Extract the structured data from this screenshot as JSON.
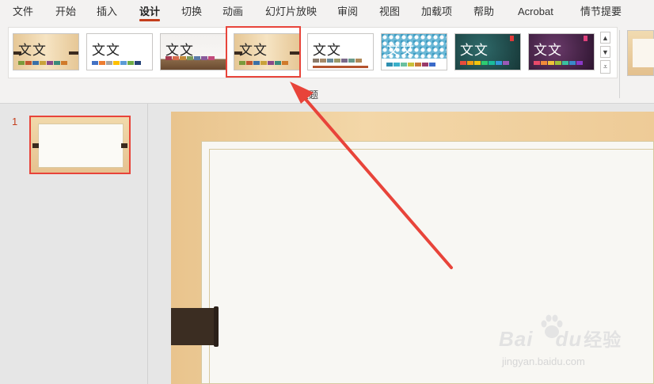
{
  "tabs": [
    "文件",
    "开始",
    "插入",
    "设计",
    "切换",
    "动画",
    "幻灯片放映",
    "审阅",
    "视图",
    "加载项",
    "帮助",
    "Acrobat",
    "情节提要"
  ],
  "active_tab": "设计",
  "ribbon": {
    "group_label": "主题",
    "themes": [
      {
        "sample": "文文",
        "swatches": [
          "#7a9a3a",
          "#c0552e",
          "#3a6fa6",
          "#c9a23a",
          "#8a4a8a",
          "#3a8a7a",
          "#d07a2a"
        ]
      },
      {
        "sample": "文文",
        "swatches": [
          "#4472c4",
          "#ed7d31",
          "#a5a5a5",
          "#ffc000",
          "#5b9bd5",
          "#70ad47",
          "#264478"
        ]
      },
      {
        "sample": "文文",
        "swatches": [
          "#a63a50",
          "#d66a4a",
          "#c28a3a",
          "#7a9a5a",
          "#5a7aa6",
          "#8a5a9a",
          "#c24a7a"
        ]
      },
      {
        "sample": "文文",
        "swatches": [
          "#7a9a3a",
          "#c0552e",
          "#3a6fa6",
          "#c9a23a",
          "#8a4a8a",
          "#3a8a7a",
          "#d07a2a"
        ]
      },
      {
        "sample": "文文",
        "swatches": [
          "#8a7a6a",
          "#a68a6a",
          "#6a8a9a",
          "#9a9a6a",
          "#7a6a8a",
          "#6a9a8a",
          "#b08a5a"
        ]
      },
      {
        "sample": "文文",
        "swatches": [
          "#2e8fb0",
          "#3ab0c9",
          "#6ac0a0",
          "#c9c03a",
          "#c97a3a",
          "#9a3a6a",
          "#3a6ac9"
        ]
      },
      {
        "sample": "文文",
        "swatches": [
          "#e74c3c",
          "#f39c12",
          "#f1c40f",
          "#2ecc71",
          "#1abc9c",
          "#3498db",
          "#9b59b6"
        ]
      },
      {
        "sample": "文文",
        "swatches": [
          "#e84a6a",
          "#f08a3a",
          "#f0c03a",
          "#a0c03a",
          "#3ac0a0",
          "#3a8ac9",
          "#8a3ac9"
        ]
      }
    ]
  },
  "slides": {
    "current_number": "1"
  },
  "watermark": {
    "brand": "Bai",
    "brand2": "du",
    "brand_cn": "经验",
    "url": "jingyan.baidu.com"
  },
  "colors": {
    "accent": "#c43e1c",
    "highlight": "#e8443a"
  }
}
